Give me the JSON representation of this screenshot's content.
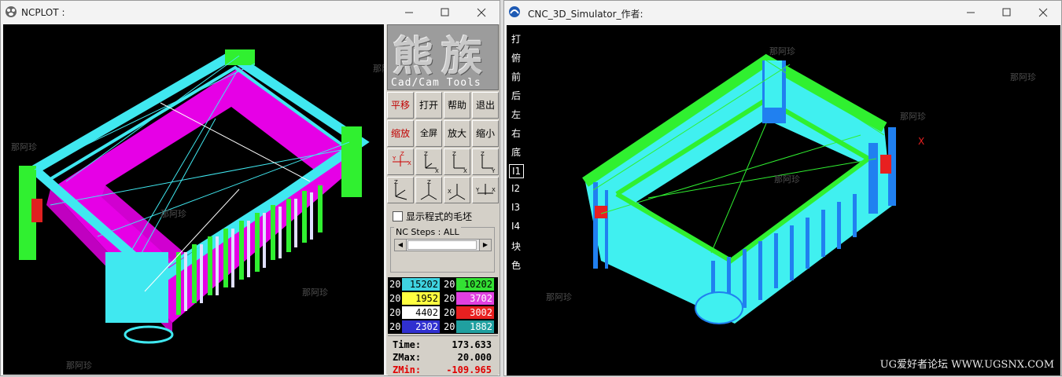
{
  "left_window": {
    "title": "NCPLOT :",
    "logo": {
      "big": "熊族",
      "sub": "Cad/Cam Tools"
    },
    "buttons_row1": [
      "平移",
      "打开",
      "帮助",
      "退出"
    ],
    "buttons_row2": [
      "缩放",
      "全屏幕",
      "放大",
      "缩小"
    ],
    "view_buttons": [
      "view-yzx-icon",
      "view-zyx-icon",
      "view-zx-icon",
      "view-zy-icon",
      "view-zxy-icon",
      "view-zxy2-icon",
      "view-xzy-icon",
      "view-yzx2-icon"
    ],
    "checkbox_label": "显示程式的毛坯",
    "steps_label": "NC Steps : ALL",
    "color_table": [
      {
        "left_prefix": "20",
        "left_value": "15202",
        "left_color": "#3fd3e0",
        "right_prefix": "20",
        "right_value": "10202",
        "right_color": "#33e033"
      },
      {
        "left_prefix": "20",
        "left_value": "1952",
        "left_color": "#ffff40",
        "right_prefix": "20",
        "right_value": "3702",
        "right_color": "#e040e0"
      },
      {
        "left_prefix": "20",
        "left_value": "4402",
        "left_color": "#ffffff",
        "right_prefix": "20",
        "right_value": "3002",
        "right_color": "#e82020"
      },
      {
        "left_prefix": "20",
        "left_value": "2302",
        "left_color": "#3030d0",
        "right_prefix": "20",
        "right_value": "1882",
        "right_color": "#20a0a0"
      }
    ],
    "stats": [
      {
        "key": "Time:",
        "value": "173.633",
        "color": "#000000"
      },
      {
        "key": "ZMax:",
        "value": "20.000",
        "color": "#000000"
      },
      {
        "key": "ZMin:",
        "value": "-109.965",
        "color": "#e00000"
      }
    ],
    "watermark": "那阿珍"
  },
  "right_window": {
    "title": "CNC_3D_Simulator_作者:",
    "menu": [
      "打",
      "俯",
      "前",
      "后",
      "左",
      "右",
      "底",
      "I1",
      "I2",
      "I3",
      "I4",
      "块",
      "色"
    ],
    "selected_menu": "I1",
    "axis_label": "X",
    "footer": "UG爱好者论坛 WWW.UGSNX.COM",
    "watermark": "那阿珍"
  }
}
